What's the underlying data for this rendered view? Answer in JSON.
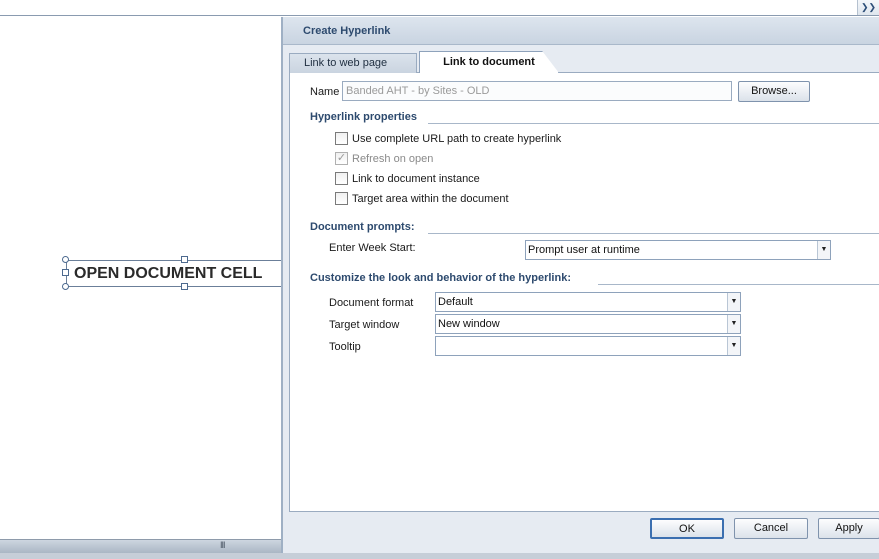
{
  "top_bar": {
    "scroll_glyph": "❯❯"
  },
  "canvas": {
    "cell_text": "OPEN DOCUMENT CELL",
    "grip_glyph": "III"
  },
  "dialog": {
    "title": "Create Hyperlink",
    "tabs": [
      {
        "label": "Link to web page",
        "active": false
      },
      {
        "label": "Link to document",
        "active": true
      }
    ],
    "name": {
      "label": "Name",
      "value": "Banded AHT - by Sites - OLD",
      "browse_label": "Browse..."
    },
    "hyperlink_properties": {
      "heading": "Hyperlink properties",
      "options": [
        {
          "label": "Use complete URL path to create hyperlink",
          "checked": false,
          "disabled": false
        },
        {
          "label": "Refresh on open",
          "checked": true,
          "disabled": true
        },
        {
          "label": "Link to document instance",
          "checked": false,
          "disabled": false
        },
        {
          "label": "Target area within the document",
          "checked": false,
          "disabled": false
        }
      ]
    },
    "document_prompts": {
      "heading": "Document prompts:",
      "prompt_label": "Enter Week Start:",
      "prompt_value": "Prompt user at runtime"
    },
    "customize": {
      "heading": "Customize the look and behavior of the hyperlink:",
      "document_format_label": "Document format",
      "document_format_value": "Default",
      "target_window_label": "Target window",
      "target_window_value": "New window",
      "tooltip_label": "Tooltip",
      "tooltip_value": ""
    },
    "buttons": {
      "ok": "OK",
      "cancel": "Cancel",
      "apply": "Apply"
    }
  },
  "icons": {
    "dropdown": "chevron-down-icon",
    "check": "checkmark-icon",
    "scroll": "double-chevron-icon"
  },
  "colors": {
    "accent": "#2d4a6e",
    "dialog_bg": "#e6ebf2",
    "border": "#9aabc0"
  }
}
